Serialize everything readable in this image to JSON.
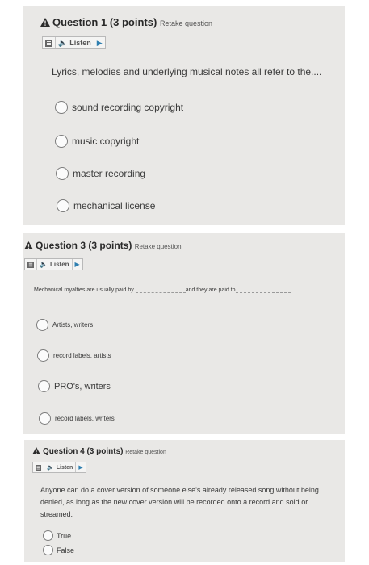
{
  "q1": {
    "title": "Question 1",
    "points": "(3 points)",
    "retake": "Retake question",
    "listen": "Listen",
    "text": "Lyrics, melodies and underlying musical notes all refer to the....",
    "options": [
      "sound recording copyright",
      "music copyright",
      "master recording",
      "mechanical license"
    ]
  },
  "q3": {
    "title": "Question 3",
    "points": "(3 points)",
    "retake": "Retake question",
    "listen": "Listen",
    "text_part1": "Mechanical royalties are usually paid by",
    "text_part2": "and they are paid to",
    "options": [
      "Artists, writers",
      "record labels, artists",
      "PRO's, writers",
      "record labels, writers"
    ]
  },
  "q4": {
    "title": "Question 4",
    "points": "(3 points)",
    "retake": "Retake question",
    "listen": "Listen",
    "text": "Anyone can do a cover version of someone else's already released song without being denied, as long as the new cover version will be recorded onto a record and sold or streamed.",
    "options": [
      "True",
      "False"
    ]
  },
  "colors": {
    "card": "#e9e8e6",
    "warning": "#2b2b2b",
    "play": "#2f7fb0"
  }
}
